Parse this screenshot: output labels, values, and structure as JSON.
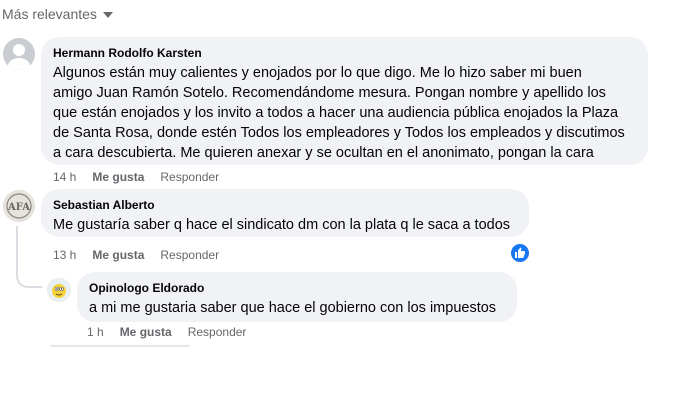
{
  "sort": {
    "label": "Más relevantes",
    "icon": "caret-down-icon"
  },
  "comments": [
    {
      "author": "Hermann Rodolfo Karsten",
      "lines": [
        "Algunos están muy calientes y enojados por lo que digo. Me lo hizo saber mi buen",
        "amigo Juan Ramón Sotelo. Recomendándome mesura. Pongan nombre y apellido los",
        "que están enojados y los invito a todos a hacer una audiencia pública enojados la Plaza",
        "de Santa Rosa, donde estén Todos los empleadores y Todos los empleados y discutimos",
        "a cara descubierta. Me quieren anexar y se ocultan en el anonimato, pongan la cara"
      ],
      "time": "14 h",
      "like": "Me gusta",
      "reply": "Responder"
    },
    {
      "author": "Sebastian Alberto",
      "lines": [
        "Me gustaría saber q hace el sindicato dm con la plata q le saca a todos"
      ],
      "time": "13 h",
      "like": "Me gusta",
      "reply": "Responder",
      "reaction": "like-icon"
    },
    {
      "author": "Opinologo Eldorado",
      "lines": [
        "a mi me gustaria saber que hace el gobierno con los impuestos"
      ],
      "time": "1 h",
      "like": "Me gusta",
      "reply": "Responder"
    }
  ],
  "colors": {
    "bubble": "#f0f2f5",
    "meta": "#65676b",
    "accent": "#1877f2"
  }
}
